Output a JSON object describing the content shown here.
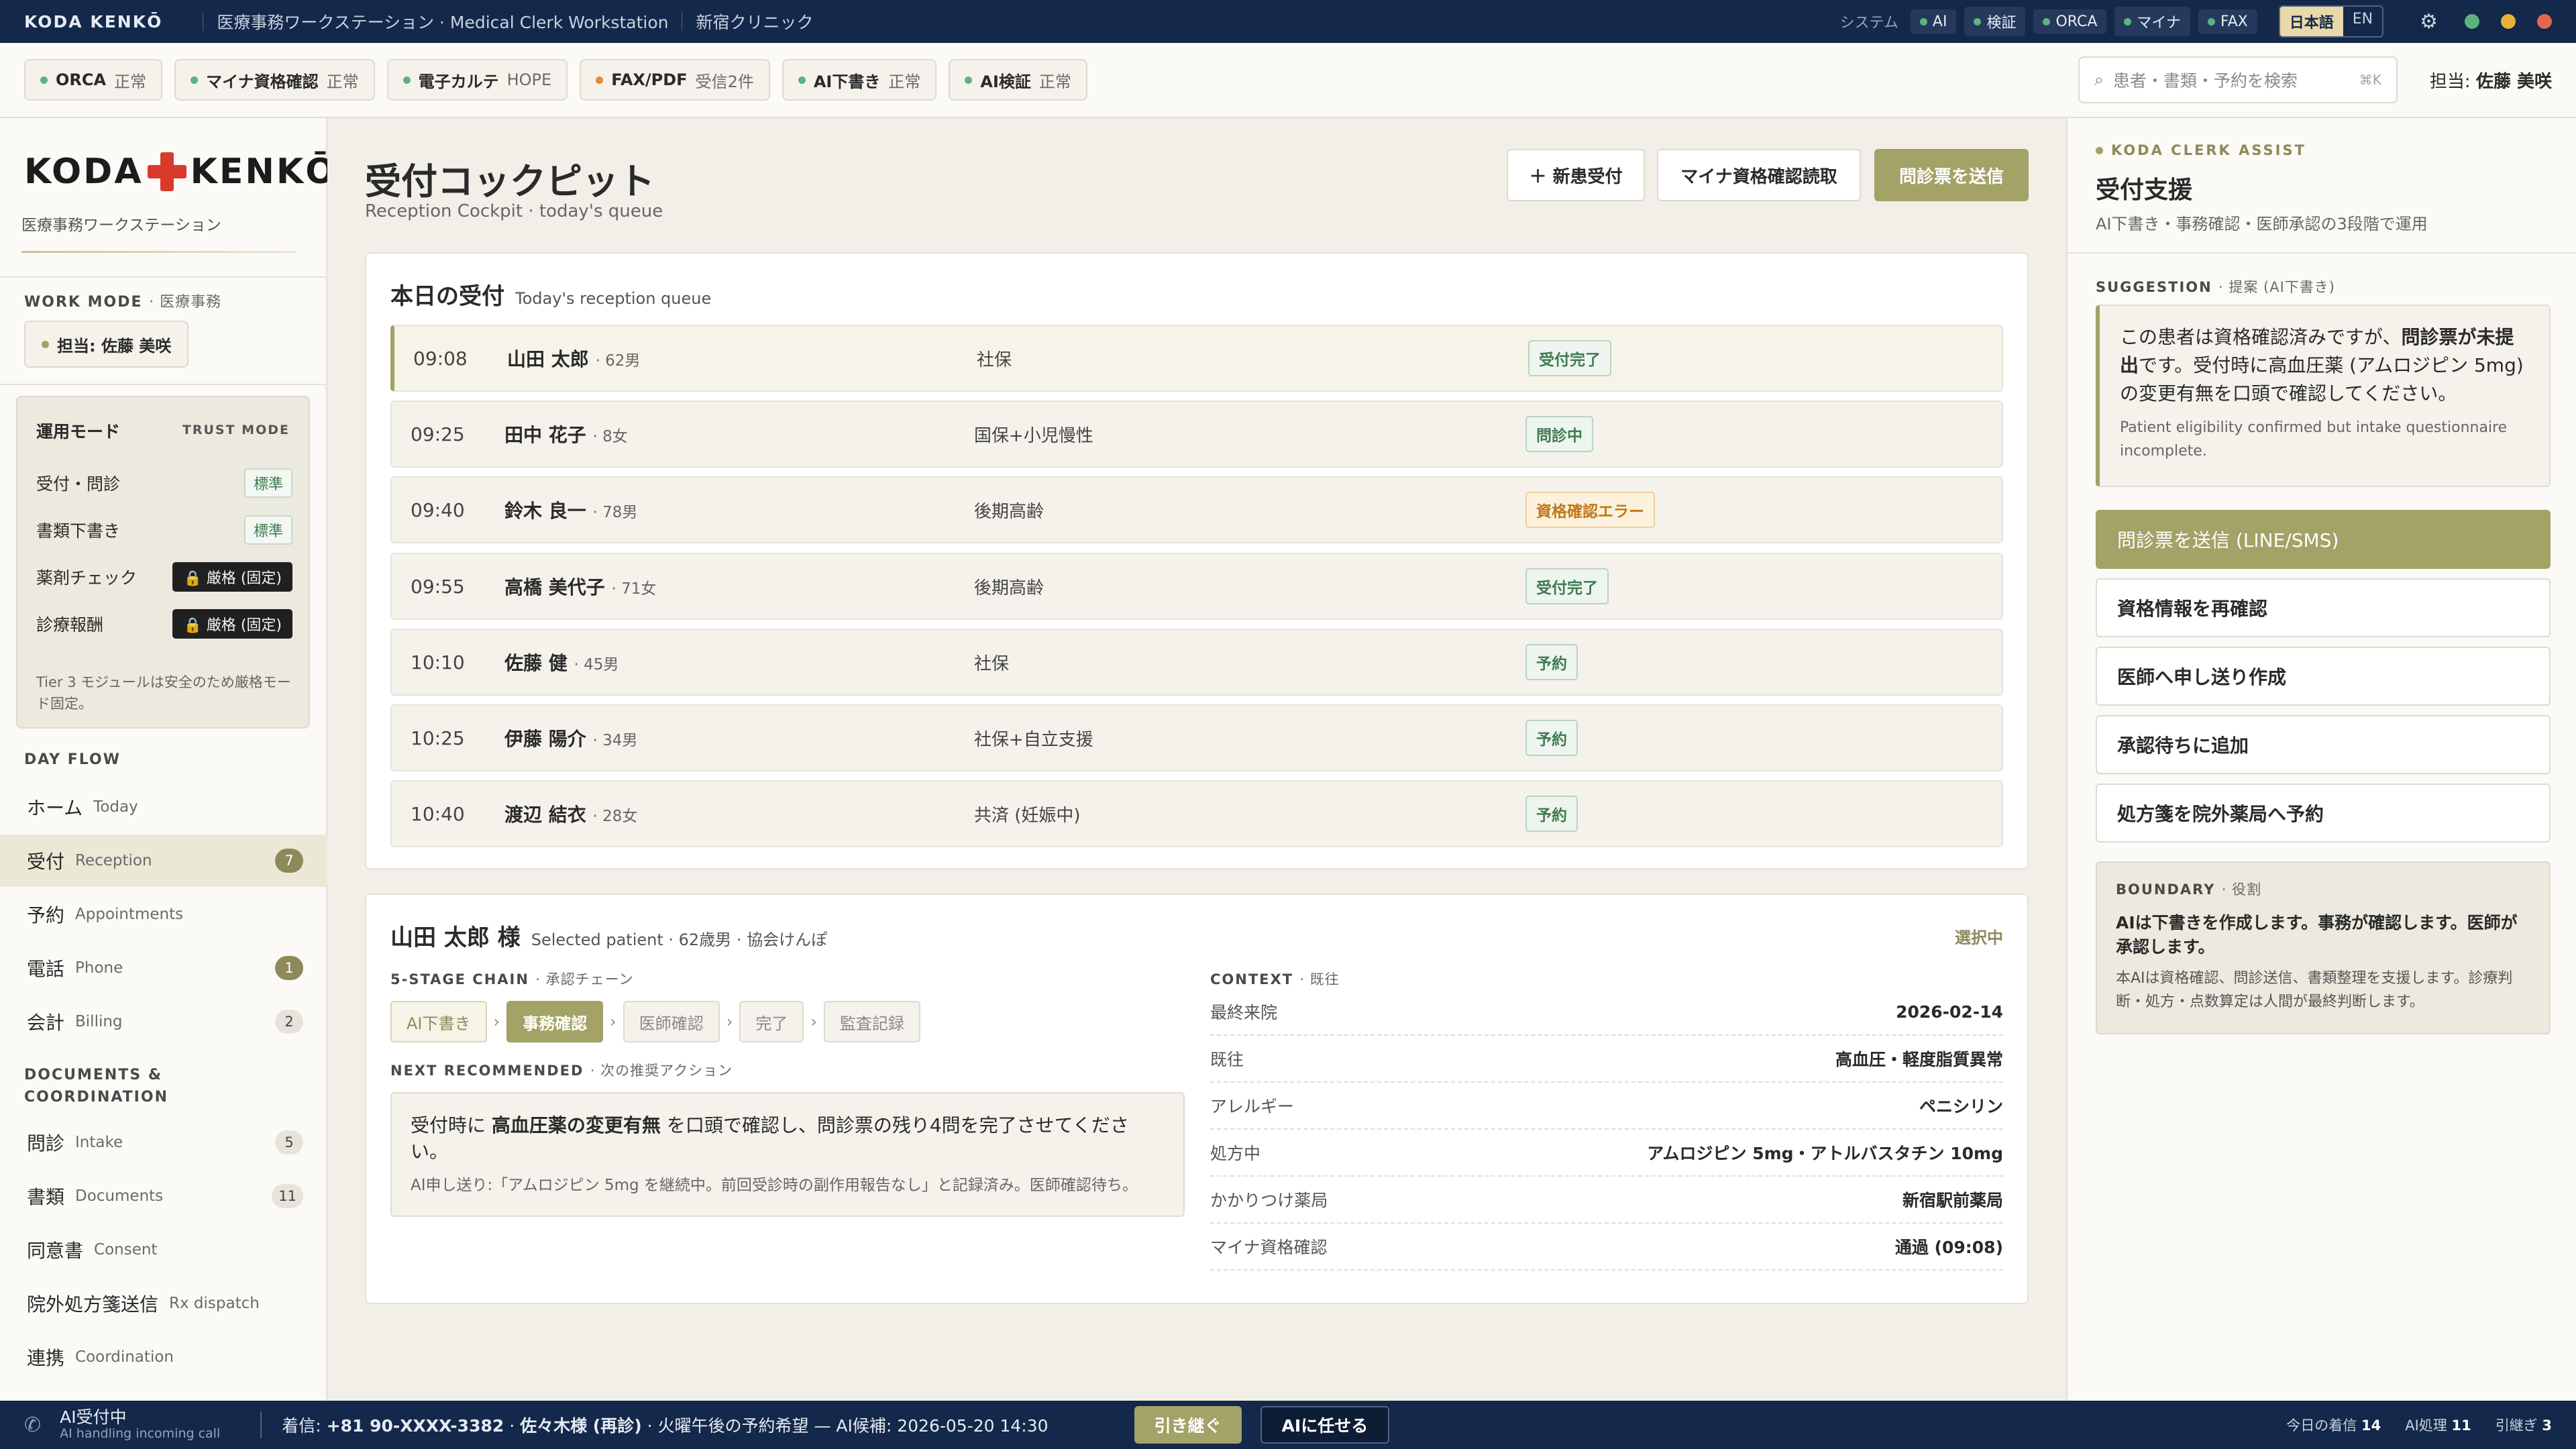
{
  "topbar": {
    "brand_a": "KODA",
    "brand_b": "KENKŌ",
    "app_title": "医療事務ワークステーション · Medical Clerk Workstation",
    "clinic": "新宿クリニック",
    "system_label": "システム",
    "system_items": [
      "AI",
      "検証",
      "ORCA",
      "マイナ",
      "FAX"
    ],
    "lang_ja": "日本語",
    "lang_en": "EN"
  },
  "status": {
    "items": [
      {
        "name": "ORCA",
        "state": "正常",
        "color": "green"
      },
      {
        "name": "マイナ資格確認",
        "state": "正常",
        "color": "green"
      },
      {
        "name": "電子カルテ",
        "state": "HOPE",
        "color": "green"
      },
      {
        "name": "FAX/PDF",
        "state": "受信2件",
        "color": "orange"
      },
      {
        "name": "AI下書き",
        "state": "正常",
        "color": "green"
      },
      {
        "name": "AI検証",
        "state": "正常",
        "color": "green"
      }
    ],
    "search_placeholder": "患者・書類・予約を検索",
    "search_shortcut": "⌘K",
    "owner_label": "担当:",
    "owner_name": "佐藤 美咲"
  },
  "sidebar": {
    "logo_a": "KODA",
    "logo_b": "KENKŌ",
    "logo_sub": "医療事務ワークステーション",
    "work_mode_label": "WORK MODE",
    "work_mode_value": "· 医療事務",
    "owner_chip": "担当: 佐藤 美咲",
    "trust": {
      "title": "運用モード",
      "tag": "TRUST MODE",
      "rows": [
        {
          "label": "受付・問診",
          "mode": "標準",
          "strict": false
        },
        {
          "label": "書類下書き",
          "mode": "標準",
          "strict": false
        },
        {
          "label": "薬剤チェック",
          "mode": "🔒 厳格 (固定)",
          "strict": true
        },
        {
          "label": "診療報酬",
          "mode": "🔒 厳格 (固定)",
          "strict": true
        }
      ],
      "note": "Tier 3 モジュールは安全のため厳格モード固定。"
    },
    "dayflow_label": "DAY FLOW",
    "dayflow": [
      {
        "ja": "ホーム",
        "en": "Today",
        "count": ""
      },
      {
        "ja": "受付",
        "en": "Reception",
        "count": "7"
      },
      {
        "ja": "予約",
        "en": "Appointments",
        "count": ""
      },
      {
        "ja": "電話",
        "en": "Phone",
        "count": "1"
      },
      {
        "ja": "会計",
        "en": "Billing",
        "count": "2"
      }
    ],
    "docs_label": "DOCUMENTS &",
    "docs_label2": "COORDINATION",
    "docs": [
      {
        "ja": "問診",
        "en": "Intake",
        "count": "5"
      },
      {
        "ja": "書類",
        "en": "Documents",
        "count": "11"
      },
      {
        "ja": "同意書",
        "en": "Consent",
        "count": ""
      },
      {
        "ja": "院外処方箋送信",
        "en": "Rx dispatch",
        "count": ""
      },
      {
        "ja": "連携",
        "en": "Coordination",
        "count": ""
      }
    ]
  },
  "main": {
    "title": "受付コックピット",
    "subtitle": "Reception Cockpit · today's queue",
    "btn_new": "＋ 新患受付",
    "btn_mynumber": "マイナ資格確認読取",
    "btn_send": "問診票を送信",
    "queue_title": "本日の受付",
    "queue_sub": "Today's reception queue",
    "queue": [
      {
        "time": "09:08",
        "name": "山田 太郎",
        "meta": "· 62男",
        "insurance": "社保",
        "status": "受付完了",
        "type": "ok"
      },
      {
        "time": "09:25",
        "name": "田中 花子",
        "meta": "· 8女",
        "insurance": "国保+小児慢性",
        "status": "問診中",
        "type": "ok"
      },
      {
        "time": "09:40",
        "name": "鈴木 良一",
        "meta": "· 78男",
        "insurance": "後期高齢",
        "status": "資格確認エラー",
        "type": "err"
      },
      {
        "time": "09:55",
        "name": "高橋 美代子",
        "meta": "· 71女",
        "insurance": "後期高齢",
        "status": "受付完了",
        "type": "ok"
      },
      {
        "time": "10:10",
        "name": "佐藤 健",
        "meta": "· 45男",
        "insurance": "社保",
        "status": "予約",
        "type": "ok"
      },
      {
        "time": "10:25",
        "name": "伊藤 陽介",
        "meta": "· 34男",
        "insurance": "社保+自立支援",
        "status": "予約",
        "type": "ok"
      },
      {
        "time": "10:40",
        "name": "渡辺 結衣",
        "meta": "· 28女",
        "insurance": "共済 (妊娠中)",
        "status": "予約",
        "type": "ok"
      }
    ],
    "patient": {
      "name": "山田 太郎 様",
      "sub": "Selected patient · 62歳男 · 協会けんぽ",
      "status": "選択中",
      "chain_label": "5-STAGE CHAIN",
      "chain_label_ja": "· 承認チェーン",
      "stages": [
        {
          "label": "AI下書き",
          "state": "done"
        },
        {
          "label": "事務確認",
          "state": "current"
        },
        {
          "label": "医師確認",
          "state": "todo"
        },
        {
          "label": "完了",
          "state": "todo"
        },
        {
          "label": "監査記録",
          "state": "todo"
        }
      ],
      "next_label": "NEXT RECOMMENDED",
      "next_label_ja": "· 次の推奨アクション",
      "next_pre": "受付時に",
      "next_bold": "高血圧薬の変更有無",
      "next_post": "を口頭で確認し、問診票の残り4問を完了させてください。",
      "next_sub": "AI申し送り:「アムロジピン 5mg を継続中。前回受診時の副作用報告なし」と記録済み。医師確認待ち。",
      "context_label": "CONTEXT",
      "context_label_ja": "· 既往",
      "context": [
        {
          "k": "最終来院",
          "v": "2026-02-14"
        },
        {
          "k": "既往",
          "v": "高血圧・軽度脂質異常"
        },
        {
          "k": "アレルギー",
          "v": "ペニシリン"
        },
        {
          "k": "処方中",
          "v": "アムロジピン 5mg・アトルバスタチン 10mg"
        },
        {
          "k": "かかりつけ薬局",
          "v": "新宿駅前薬局"
        },
        {
          "k": "マイナ資格確認",
          "v": "通過 (09:08)"
        }
      ]
    }
  },
  "assist": {
    "tag": "KODA CLERK ASSIST",
    "title": "受付支援",
    "sub": "AI下書き・事務確認・医師承認の3段階で運用",
    "sugg_label": "SUGGESTION",
    "sugg_label_ja": "· 提案 (AI下書き)",
    "sugg_pre": "この患者は資格確認済みですが、",
    "sugg_bold": "問診票が未提出",
    "sugg_post": "です。受付時に高血圧薬 (アムロジピン 5mg) の変更有無を口頭で確認してください。",
    "sugg_sub": "Patient eligibility confirmed but intake questionnaire incomplete.",
    "actions": [
      "問診票を送信 (LINE/SMS)",
      "資格情報を再確認",
      "医師へ申し送り作成",
      "承認待ちに追加",
      "処方箋を院外薬局へ予約"
    ],
    "bound_label": "BOUNDARY",
    "bound_label_ja": "· 役割",
    "bound_main": "AIは下書きを作成します。事務が確認します。医師が承認します。",
    "bound_sub": "本AIは資格確認、問診送信、書類整理を支援します。診療判断・処方・点数算定は人間が最終判断します。"
  },
  "bottom": {
    "title": "AI受付中",
    "sub": "AI handling incoming call",
    "call_pre": "着信: ",
    "call_num": "+81 90-XXXX-3382",
    "call_mid": " · ",
    "call_name": "佐々木様 (再診)",
    "call_post": " · 火曜午後の予約希望 — AI候補: 2026-05-20 14:30",
    "btn_take": "引き継ぐ",
    "btn_ai": "AIに任せる",
    "stat1_label": "今日の着信",
    "stat1_value": "14",
    "stat2_label": "AI処理",
    "stat2_value": "11",
    "stat3_label": "引継ぎ",
    "stat3_value": "3"
  },
  "colors": {
    "olive": "#a3a267",
    "navy": "#13284a",
    "green": "#5db37e",
    "orange": "#e88a3a",
    "error": "#c07718"
  }
}
